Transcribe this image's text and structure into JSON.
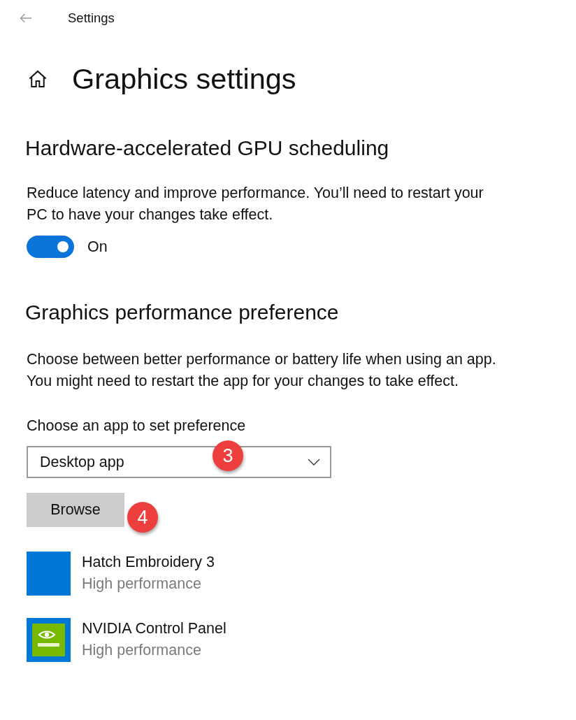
{
  "window": {
    "title": "Settings"
  },
  "page": {
    "title": "Graphics settings"
  },
  "gpu_scheduling": {
    "heading": "Hardware-accelerated GPU scheduling",
    "description": "Reduce latency and improve performance. You’ll need to restart your PC to have your changes take effect.",
    "toggle": {
      "on": true,
      "label": "On"
    }
  },
  "performance_preference": {
    "heading": "Graphics performance preference",
    "description": "Choose between better performance or battery life when using an app. You might need to restart the app for your changes to take effect.",
    "app_type_label": "Choose an app to set preference",
    "app_type_dropdown": {
      "value": "Desktop app",
      "annotation": "3"
    },
    "browse_button": {
      "label": "Browse",
      "annotation": "4"
    },
    "apps": [
      {
        "name": "Hatch Embroidery 3",
        "preference": "High performance",
        "kind": "plain"
      },
      {
        "name": "NVIDIA Control Panel",
        "preference": "High performance",
        "kind": "logo"
      }
    ]
  }
}
